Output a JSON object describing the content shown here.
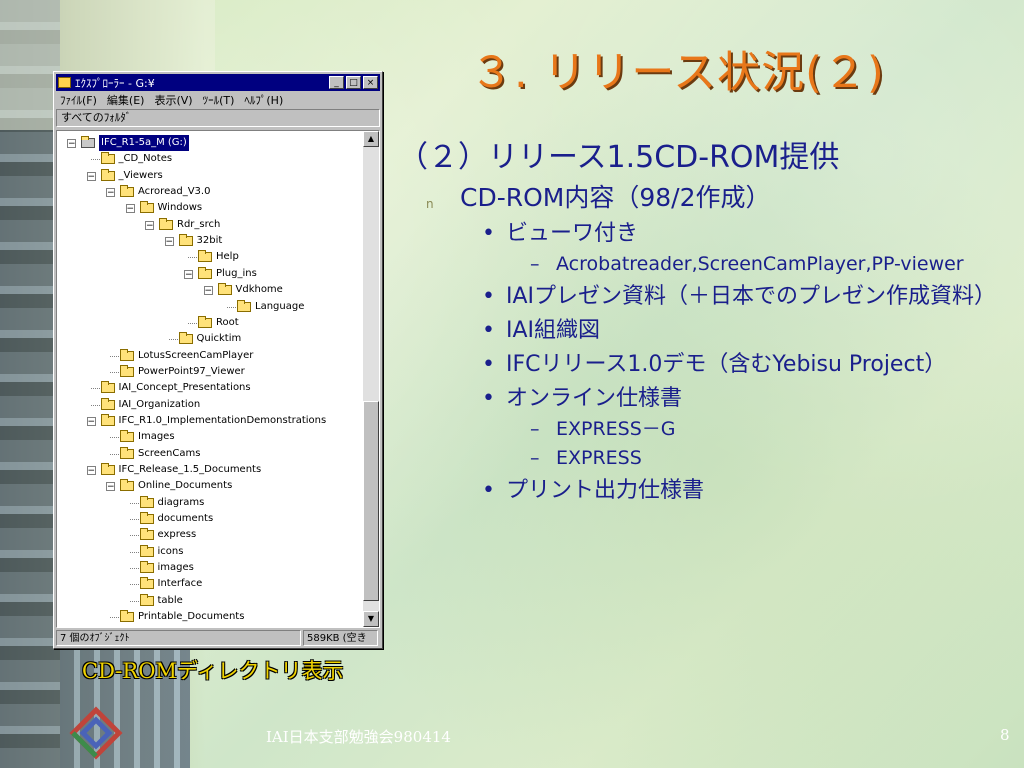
{
  "slide": {
    "title": "３. リリース状況(２)",
    "subtitle": "（２）リリース1.5CD-ROM提供",
    "level1": {
      "marker": "n",
      "text": "CD-ROM内容（98/2作成）"
    },
    "items": [
      {
        "text": "ビューワ付き",
        "sub": [
          "Acrobatreader,ScreenCamPlayer,PP-viewer"
        ]
      },
      {
        "text": "IAIプレゼン資料（＋日本でのプレゼン作成資料）",
        "sub": []
      },
      {
        "text": "IAI組織図",
        "sub": []
      },
      {
        "text": "IFCリリース1.0デモ（含むYebisu Project）",
        "sub": []
      },
      {
        "text": "オンライン仕様書",
        "sub": [
          "EXPRESS－G",
          "EXPRESS"
        ]
      },
      {
        "text": "プリント出力仕様書",
        "sub": []
      }
    ],
    "caption": "CD-ROMディレクトリ表示",
    "footer": "IAI日本支部勉強会980414",
    "page_number": "8"
  },
  "explorer": {
    "title": "ｴｸｽﾌﾟﾛｰﾗｰ - G:¥",
    "menu": [
      "ﾌｧｲﾙ(F)",
      "編集(E)",
      "表示(V)",
      "ﾂｰﾙ(T)",
      "ﾍﾙﾌﾟ(H)"
    ],
    "pane_header": "すべてのﾌｫﾙﾀﾞ",
    "status_left": "7 個のｵﾌﾞｼﾞｪｸﾄ",
    "status_right": "589KB (空き",
    "tree": [
      {
        "label": "IFC_R1-5a_M (G:)",
        "depth": 0,
        "exp": "-",
        "selected": true
      },
      {
        "label": "_CD_Notes",
        "depth": 1,
        "exp": ""
      },
      {
        "label": "_Viewers",
        "depth": 1,
        "exp": "-"
      },
      {
        "label": "Acroread_V3.0",
        "depth": 2,
        "exp": "-"
      },
      {
        "label": "Windows",
        "depth": 3,
        "exp": "-"
      },
      {
        "label": "Rdr_srch",
        "depth": 4,
        "exp": "-"
      },
      {
        "label": "32bit",
        "depth": 5,
        "exp": "-"
      },
      {
        "label": "Help",
        "depth": 6,
        "exp": ""
      },
      {
        "label": "Plug_ins",
        "depth": 6,
        "exp": "-"
      },
      {
        "label": "Vdkhome",
        "depth": 7,
        "exp": "-"
      },
      {
        "label": "Language",
        "depth": 8,
        "exp": ""
      },
      {
        "label": "Root",
        "depth": 6,
        "exp": ""
      },
      {
        "label": "Quicktim",
        "depth": 5,
        "exp": ""
      },
      {
        "label": "LotusScreenCamPlayer",
        "depth": 2,
        "exp": ""
      },
      {
        "label": "PowerPoint97_Viewer",
        "depth": 2,
        "exp": ""
      },
      {
        "label": "IAI_Concept_Presentations",
        "depth": 1,
        "exp": ""
      },
      {
        "label": "IAI_Organization",
        "depth": 1,
        "exp": ""
      },
      {
        "label": "IFC_R1.0_ImplementationDemonstrations",
        "depth": 1,
        "exp": "-"
      },
      {
        "label": "Images",
        "depth": 2,
        "exp": ""
      },
      {
        "label": "ScreenCams",
        "depth": 2,
        "exp": ""
      },
      {
        "label": "IFC_Release_1.5_Documents",
        "depth": 1,
        "exp": "-"
      },
      {
        "label": "Online_Documents",
        "depth": 2,
        "exp": "-"
      },
      {
        "label": "diagrams",
        "depth": 3,
        "exp": ""
      },
      {
        "label": "documents",
        "depth": 3,
        "exp": ""
      },
      {
        "label": "express",
        "depth": 3,
        "exp": ""
      },
      {
        "label": "icons",
        "depth": 3,
        "exp": ""
      },
      {
        "label": "images",
        "depth": 3,
        "exp": ""
      },
      {
        "label": "Interface",
        "depth": 3,
        "exp": ""
      },
      {
        "label": "table",
        "depth": 3,
        "exp": ""
      },
      {
        "label": "Printable_Documents",
        "depth": 2,
        "exp": ""
      }
    ]
  },
  "colors": {
    "title": "#e8771a",
    "body_text": "#1a1f8c",
    "caption": "#f1d400",
    "selection": "#000080"
  }
}
